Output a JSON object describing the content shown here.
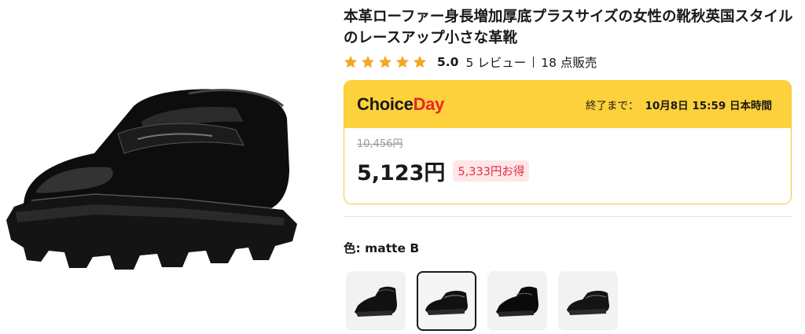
{
  "product": {
    "title": "本革ローファー身長増加厚底プラスサイズの女性の靴秋英国スタイルのレースアップ小さな革靴",
    "rating": 5.0,
    "rating_text": "5.0",
    "reviews_text": "5 レビュー",
    "sold_text": "18 点販売",
    "star_color": "#f5a623"
  },
  "promo": {
    "logo_part1": "Choice",
    "logo_part2": "Day",
    "ends_label": "終了まで：",
    "ends_date": "10月8日 15:59 日本時間",
    "header_color": "#fdd13b",
    "original_price": "10,456円",
    "current_price": "5,123円",
    "savings": "5,333円お得"
  },
  "variants": {
    "color_label": "色: matte B",
    "selected_index": 1,
    "items": [
      {
        "icon": "shoe-thumbnail-icon"
      },
      {
        "icon": "shoe-thumbnail-icon"
      },
      {
        "icon": "shoe-thumbnail-icon"
      },
      {
        "icon": "shoe-thumbnail-icon"
      }
    ]
  }
}
